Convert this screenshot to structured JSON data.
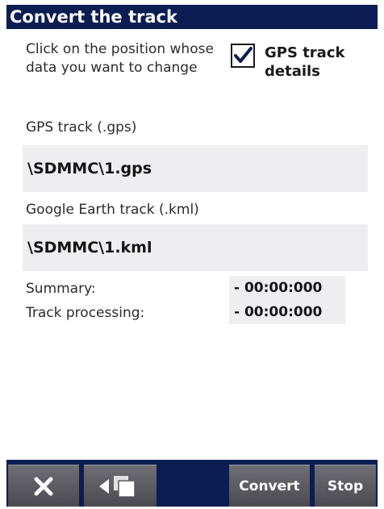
{
  "window": {
    "title": "Convert the track"
  },
  "instruction": "Click on the position whose data you want to change",
  "gps_details": {
    "label": "GPS track details",
    "checked": true
  },
  "gps_track": {
    "label": "GPS track (.gps)",
    "value": "\\SDMMC\\1.gps"
  },
  "kml_track": {
    "label": "Google Earth track (.kml)",
    "value": "\\SDMMC\\1.kml"
  },
  "summary": {
    "summary_label": "Summary:",
    "summary_value": "- 00:00:000",
    "processing_label": "Track processing:",
    "processing_value": "- 00:00:000"
  },
  "toolbar": {
    "close_icon": "close-icon",
    "back_icon": "back-windows-icon",
    "convert_label": "Convert",
    "stop_label": "Stop"
  },
  "colors": {
    "title_bar": "#0b1d52",
    "field_bg": "#eeeef0",
    "button_bg": "#5c5c62"
  }
}
